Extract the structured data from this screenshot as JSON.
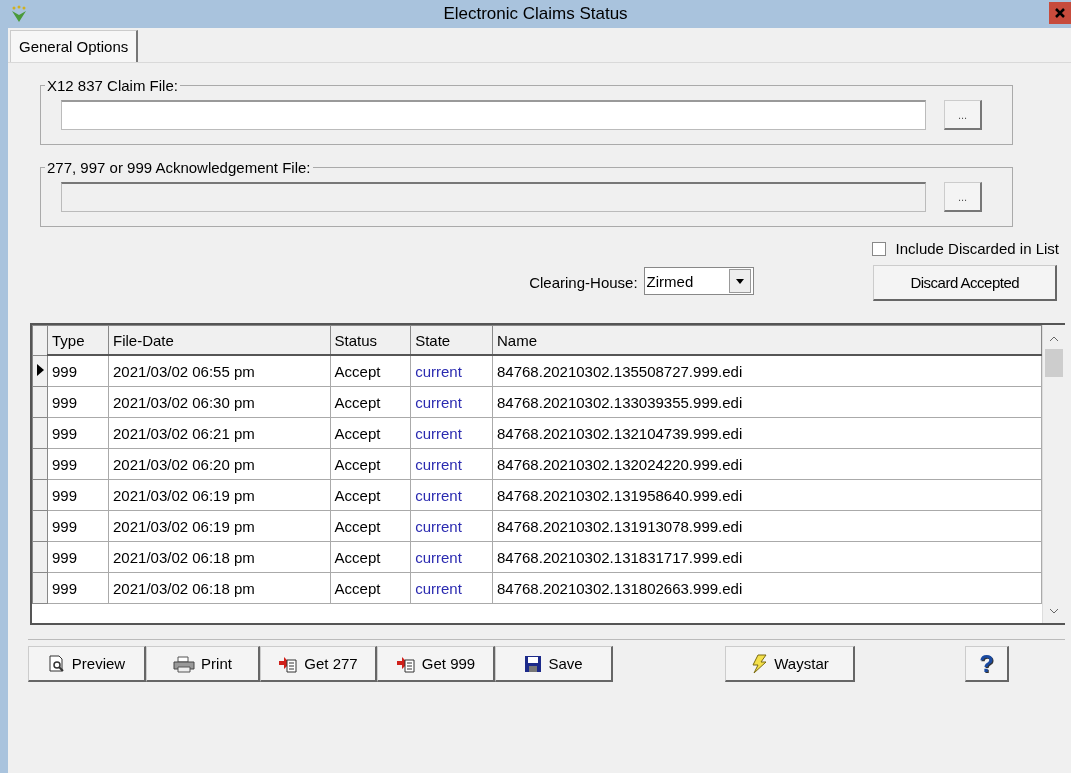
{
  "window": {
    "title": "Electronic Claims Status"
  },
  "tabs": [
    {
      "label": "General Options",
      "selected": true
    }
  ],
  "claim_file": {
    "legend": "X12 837 Claim File:",
    "disabled": false,
    "browse": "..."
  },
  "ack_file": {
    "legend": "277, 997 or 999 Acknowledgement File:",
    "disabled": true,
    "browse": "..."
  },
  "include_discarded": {
    "label": "Include Discarded in List",
    "checked": false
  },
  "clearing_house": {
    "label": "Clearing-House:",
    "value": "Zirmed"
  },
  "discard_button": "Discard Accepted",
  "table": {
    "columns": [
      "Type",
      "File-Date",
      "Status",
      "State",
      "Name"
    ],
    "rows": [
      {
        "selected": true,
        "cells": [
          "999",
          "2021/03/02 06:55 pm",
          "Accept",
          "current",
          "84768.20210302.135508727.999.edi"
        ]
      },
      {
        "selected": false,
        "cells": [
          "999",
          "2021/03/02 06:30 pm",
          "Accept",
          "current",
          "84768.20210302.133039355.999.edi"
        ]
      },
      {
        "selected": false,
        "cells": [
          "999",
          "2021/03/02 06:21 pm",
          "Accept",
          "current",
          "84768.20210302.132104739.999.edi"
        ]
      },
      {
        "selected": false,
        "cells": [
          "999",
          "2021/03/02 06:20 pm",
          "Accept",
          "current",
          "84768.20210302.132024220.999.edi"
        ]
      },
      {
        "selected": false,
        "cells": [
          "999",
          "2021/03/02 06:19 pm",
          "Accept",
          "current",
          "84768.20210302.131958640.999.edi"
        ]
      },
      {
        "selected": false,
        "cells": [
          "999",
          "2021/03/02 06:19 pm",
          "Accept",
          "current",
          "84768.20210302.131913078.999.edi"
        ]
      },
      {
        "selected": false,
        "cells": [
          "999",
          "2021/03/02 06:18 pm",
          "Accept",
          "current",
          "84768.20210302.131831717.999.edi"
        ]
      },
      {
        "selected": false,
        "cells": [
          "999",
          "2021/03/02 06:18 pm",
          "Accept",
          "current",
          "84768.20210302.131802663.999.edi"
        ]
      }
    ]
  },
  "toolbar": [
    {
      "kind": "preview",
      "label": "Preview"
    },
    {
      "kind": "print",
      "label": "Print"
    },
    {
      "kind": "get",
      "label": "Get 277"
    },
    {
      "kind": "get",
      "label": "Get 999"
    },
    {
      "kind": "save",
      "label": "Save"
    },
    {
      "kind": "waystar",
      "label": "Waystar"
    },
    {
      "kind": "help",
      "label": "?"
    }
  ]
}
